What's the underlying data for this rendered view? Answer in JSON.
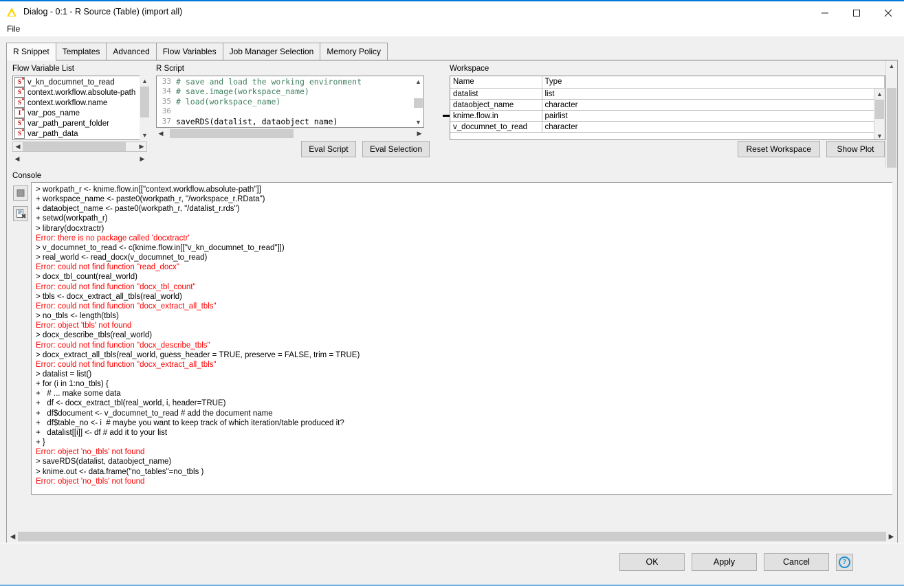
{
  "window": {
    "title": "Dialog - 0:1 - R Source (Table) (import all)",
    "app_icon": "knime-triangle-icon",
    "minimize_label": "—",
    "maximize_label": "☐",
    "close_label": "✕"
  },
  "menu": {
    "items": [
      {
        "label": "File"
      }
    ]
  },
  "tabs": [
    {
      "label": "R Snippet",
      "active": true
    },
    {
      "label": "Templates",
      "active": false
    },
    {
      "label": "Advanced",
      "active": false
    },
    {
      "label": "Flow Variables",
      "active": false
    },
    {
      "label": "Job Manager Selection",
      "active": false
    },
    {
      "label": "Memory Policy",
      "active": false
    }
  ],
  "flow_variable_list": {
    "title": "Flow Variable List",
    "items": [
      {
        "type_glyph": "S",
        "type": "string",
        "label": "v_kn_documnet_to_read"
      },
      {
        "type_glyph": "S",
        "type": "string",
        "label": "context.workflow.absolute-path"
      },
      {
        "type_glyph": "S",
        "type": "string",
        "label": "context.workflow.name"
      },
      {
        "type_glyph": "I",
        "type": "integer",
        "label": "var_pos_name"
      },
      {
        "type_glyph": "S",
        "type": "string",
        "label": "var_path_parent_folder"
      },
      {
        "type_glyph": "S",
        "type": "string",
        "label": "var_path_data"
      }
    ]
  },
  "r_script": {
    "title": "R Script",
    "lines": [
      {
        "number": "33",
        "text": "# save and load the working environment",
        "style": "comment"
      },
      {
        "number": "34",
        "text": "# save.image(workspace_name)",
        "style": "comment"
      },
      {
        "number": "35",
        "text": "# load(workspace_name)",
        "style": "comment"
      },
      {
        "number": "36",
        "text": "",
        "style": "plain"
      },
      {
        "number": "37",
        "text": "saveRDS(datalist, dataobject name)",
        "style": "plain"
      }
    ],
    "eval_script_label": "Eval Script",
    "eval_selection_label": "Eval Selection"
  },
  "workspace": {
    "title": "Workspace",
    "columns": [
      "Name",
      "Type"
    ],
    "rows": [
      {
        "name": "datalist",
        "type": "list"
      },
      {
        "name": "dataobject_name",
        "type": "character"
      },
      {
        "name": "knime.flow.in",
        "type": "pairlist"
      },
      {
        "name": "v_documnet_to_read",
        "type": "character"
      }
    ],
    "reset_label": "Reset Workspace",
    "show_plot_label": "Show Plot"
  },
  "console": {
    "title": "Console",
    "toolbar": [
      {
        "name": "cancel-execution-icon",
        "label": ""
      },
      {
        "name": "clear-console-icon",
        "label": ""
      }
    ],
    "lines": [
      {
        "text": "> workpath_r <- knime.flow.in[[\"context.workflow.absolute-path\"]]",
        "error": false
      },
      {
        "text": "+ workspace_name <- paste0(workpath_r, \"/workspace_r.RData\")",
        "error": false
      },
      {
        "text": "+ dataobject_name <- paste0(workpath_r, \"/datalist_r.rds\")",
        "error": false
      },
      {
        "text": "+ setwd(workpath_r)",
        "error": false
      },
      {
        "text": "> library(docxtractr)",
        "error": false
      },
      {
        "text": "Error: there is no package called 'docxtractr'",
        "error": true
      },
      {
        "text": "> v_documnet_to_read <- c(knime.flow.in[[\"v_kn_documnet_to_read\"]])",
        "error": false
      },
      {
        "text": "> real_world <- read_docx(v_documnet_to_read)",
        "error": false
      },
      {
        "text": "Error: could not find function \"read_docx\"",
        "error": true
      },
      {
        "text": "> docx_tbl_count(real_world)",
        "error": false
      },
      {
        "text": "Error: could not find function \"docx_tbl_count\"",
        "error": true
      },
      {
        "text": "> tbls <- docx_extract_all_tbls(real_world)",
        "error": false
      },
      {
        "text": "Error: could not find function \"docx_extract_all_tbls\"",
        "error": true
      },
      {
        "text": "> no_tbls <- length(tbls)",
        "error": false
      },
      {
        "text": "Error: object 'tbls' not found",
        "error": true
      },
      {
        "text": "> docx_describe_tbls(real_world)",
        "error": false
      },
      {
        "text": "Error: could not find function \"docx_describe_tbls\"",
        "error": true
      },
      {
        "text": "> docx_extract_all_tbls(real_world, guess_header = TRUE, preserve = FALSE, trim = TRUE)",
        "error": false
      },
      {
        "text": "Error: could not find function \"docx_extract_all_tbls\"",
        "error": true
      },
      {
        "text": "> datalist = list()",
        "error": false
      },
      {
        "text": "+ for (i in 1:no_tbls) {",
        "error": false
      },
      {
        "text": "+   # ... make some data",
        "error": false
      },
      {
        "text": "+   df <- docx_extract_tbl(real_world, i, header=TRUE)",
        "error": false
      },
      {
        "text": "+   df$document <- v_documnet_to_read # add the document name",
        "error": false
      },
      {
        "text": "+   df$table_no <- i  # maybe you want to keep track of which iteration/table produced it?",
        "error": false
      },
      {
        "text": "+   datalist[[i]] <- df # add it to your list",
        "error": false
      },
      {
        "text": "+ }",
        "error": false
      },
      {
        "text": "Error: object 'no_tbls' not found",
        "error": true
      },
      {
        "text": "> saveRDS(datalist, dataobject_name)",
        "error": false
      },
      {
        "text": "> knime.out <- data.frame(\"no_tables\"=no_tbls )",
        "error": false
      },
      {
        "text": "Error: object 'no_tbls' not found",
        "error": true
      }
    ]
  },
  "dialog_buttons": {
    "ok": "OK",
    "apply": "Apply",
    "cancel": "Cancel",
    "help": "?"
  },
  "colors": {
    "accent": "#0078d7",
    "error_text": "#ff0000",
    "comment_green": "#3f7f5f",
    "panel_bg": "#f0f0f0",
    "field_bg": "#ffffff",
    "type_icon_red": "#c00000"
  }
}
